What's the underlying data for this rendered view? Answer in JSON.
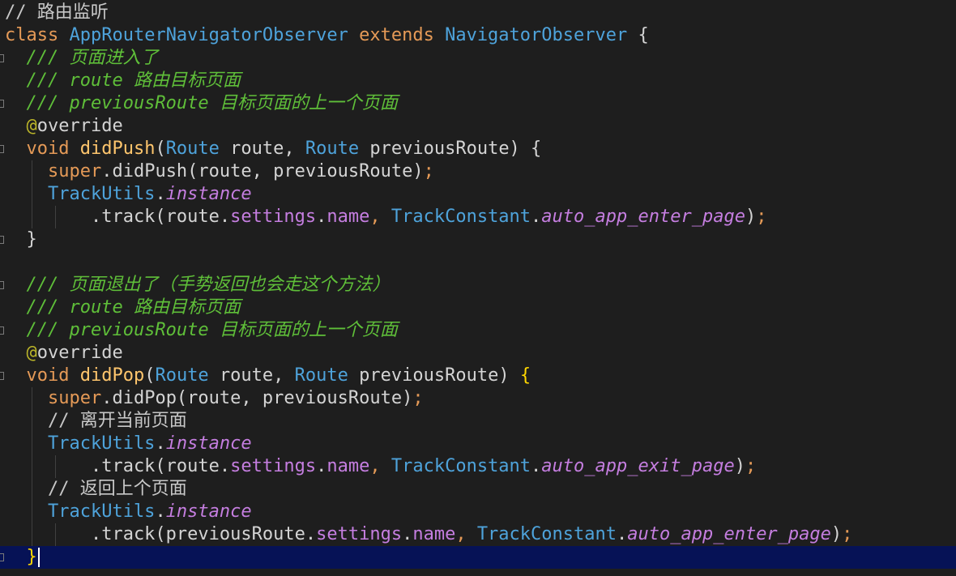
{
  "editor": {
    "lines": [
      {
        "tokens": [
          {
            "t": "// 路由监听",
            "c": "cm"
          }
        ]
      },
      {
        "tokens": [
          {
            "t": "class ",
            "c": "kw"
          },
          {
            "t": "AppRouterNavigatorObserver ",
            "c": "cls"
          },
          {
            "t": "extends ",
            "c": "kw"
          },
          {
            "t": "NavigatorObserver ",
            "c": "cls"
          },
          {
            "t": "{",
            "c": "dim"
          }
        ]
      },
      {
        "tokens": [
          {
            "t": "  /// 页面进入了",
            "c": "doc"
          }
        ]
      },
      {
        "tokens": [
          {
            "t": "  /// route 路由目标页面",
            "c": "doc"
          }
        ]
      },
      {
        "tokens": [
          {
            "t": "  /// previousRoute 目标页面的上一个页面",
            "c": "doc"
          }
        ]
      },
      {
        "tokens": [
          {
            "t": "  @",
            "c": "ann"
          },
          {
            "t": "override",
            "c": "dim"
          }
        ]
      },
      {
        "tokens": [
          {
            "t": "  void ",
            "c": "kw"
          },
          {
            "t": "didPush",
            "c": "fn"
          },
          {
            "t": "(",
            "c": "dim"
          },
          {
            "t": "Route ",
            "c": "cls"
          },
          {
            "t": "route, ",
            "c": "dim"
          },
          {
            "t": "Route ",
            "c": "cls"
          },
          {
            "t": "previousRoute) {",
            "c": "dim"
          }
        ]
      },
      {
        "tokens": [
          {
            "t": "    super",
            "c": "sup"
          },
          {
            "t": ".didPush(route, previousRoute)",
            "c": "dim"
          },
          {
            "t": ";",
            "c": "kw"
          }
        ]
      },
      {
        "tokens": [
          {
            "t": "    TrackUtils",
            "c": "cls"
          },
          {
            "t": ".",
            "c": "dim"
          },
          {
            "t": "instance",
            "c": "ital"
          }
        ]
      },
      {
        "tokens": [
          {
            "t": "        .track(route.",
            "c": "dim"
          },
          {
            "t": "settings",
            "c": "fld"
          },
          {
            "t": ".",
            "c": "dim"
          },
          {
            "t": "name",
            "c": "fld"
          },
          {
            "t": ", ",
            "c": "kw"
          },
          {
            "t": "TrackConstant",
            "c": "cls"
          },
          {
            "t": ".",
            "c": "dim"
          },
          {
            "t": "auto_app_enter_page",
            "c": "ital"
          },
          {
            "t": ")",
            "c": "dim"
          },
          {
            "t": ";",
            "c": "kw"
          }
        ]
      },
      {
        "tokens": [
          {
            "t": "  }",
            "c": "dim"
          }
        ]
      },
      {
        "tokens": [
          {
            "t": "",
            "c": "dim"
          }
        ]
      },
      {
        "tokens": [
          {
            "t": "  /// 页面退出了（手势返回也会走这个方法）",
            "c": "doc"
          }
        ]
      },
      {
        "tokens": [
          {
            "t": "  /// route 路由目标页面",
            "c": "doc"
          }
        ]
      },
      {
        "tokens": [
          {
            "t": "  /// previousRoute 目标页面的上一个页面",
            "c": "doc"
          }
        ]
      },
      {
        "tokens": [
          {
            "t": "  @",
            "c": "ann"
          },
          {
            "t": "override",
            "c": "dim"
          }
        ]
      },
      {
        "tokens": [
          {
            "t": "  void ",
            "c": "kw"
          },
          {
            "t": "didPop",
            "c": "fn"
          },
          {
            "t": "(",
            "c": "dim"
          },
          {
            "t": "Route ",
            "c": "cls"
          },
          {
            "t": "route, ",
            "c": "dim"
          },
          {
            "t": "Route ",
            "c": "cls"
          },
          {
            "t": "previousRoute) ",
            "c": "dim"
          },
          {
            "t": "{",
            "c": "brace-gold"
          }
        ]
      },
      {
        "tokens": [
          {
            "t": "    super",
            "c": "sup"
          },
          {
            "t": ".didPop(route, previousRoute)",
            "c": "dim"
          },
          {
            "t": ";",
            "c": "kw"
          }
        ]
      },
      {
        "tokens": [
          {
            "t": "    // 离开当前页面",
            "c": "cm"
          }
        ]
      },
      {
        "tokens": [
          {
            "t": "    TrackUtils",
            "c": "cls"
          },
          {
            "t": ".",
            "c": "dim"
          },
          {
            "t": "instance",
            "c": "ital"
          }
        ]
      },
      {
        "tokens": [
          {
            "t": "        .track(route.",
            "c": "dim"
          },
          {
            "t": "settings",
            "c": "fld"
          },
          {
            "t": ".",
            "c": "dim"
          },
          {
            "t": "name",
            "c": "fld"
          },
          {
            "t": ", ",
            "c": "kw"
          },
          {
            "t": "TrackConstant",
            "c": "cls"
          },
          {
            "t": ".",
            "c": "dim"
          },
          {
            "t": "auto_app_exit_page",
            "c": "ital"
          },
          {
            "t": ")",
            "c": "dim"
          },
          {
            "t": ";",
            "c": "kw"
          }
        ]
      },
      {
        "tokens": [
          {
            "t": "    // 返回上个页面",
            "c": "cm"
          }
        ]
      },
      {
        "tokens": [
          {
            "t": "    TrackUtils",
            "c": "cls"
          },
          {
            "t": ".",
            "c": "dim"
          },
          {
            "t": "instance",
            "c": "ital"
          }
        ]
      },
      {
        "tokens": [
          {
            "t": "        .track(previousRoute.",
            "c": "dim"
          },
          {
            "t": "settings",
            "c": "fld"
          },
          {
            "t": ".",
            "c": "dim"
          },
          {
            "t": "name",
            "c": "fld"
          },
          {
            "t": ", ",
            "c": "kw"
          },
          {
            "t": "TrackConstant",
            "c": "cls"
          },
          {
            "t": ".",
            "c": "dim"
          },
          {
            "t": "auto_app_enter_page",
            "c": "ital"
          },
          {
            "t": ")",
            "c": "dim"
          },
          {
            "t": ";",
            "c": "kw"
          }
        ]
      },
      {
        "tokens": [
          {
            "t": "  }",
            "c": "brace-gold"
          }
        ]
      }
    ],
    "current_line": 24,
    "gutter_marks": [
      2,
      4,
      6,
      10,
      12,
      14,
      16,
      24
    ],
    "colors": {
      "background": "#1e1e1e",
      "current_line": "#061256",
      "comment": "#c8c8c8",
      "doc_comment": "#5fbf39",
      "keyword": "#e59a57",
      "type": "#4ea3db",
      "function": "#ffc66d",
      "field": "#c57ee0"
    }
  }
}
